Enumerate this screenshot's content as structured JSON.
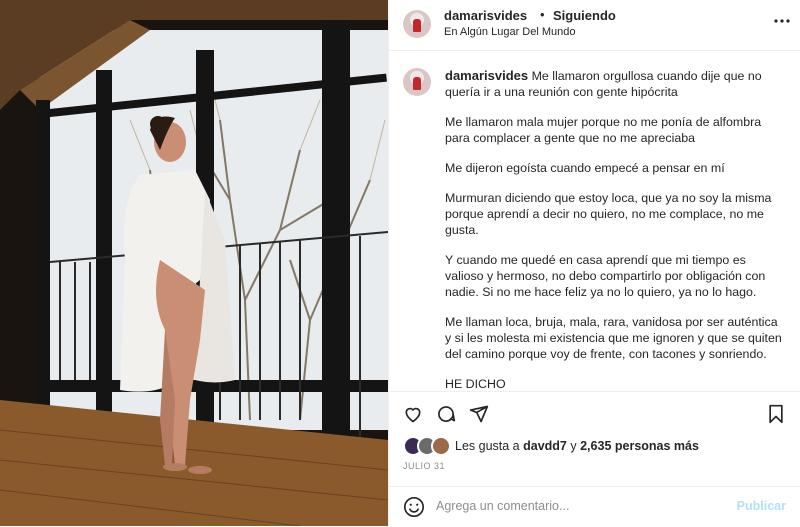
{
  "header": {
    "username": "damarisvides",
    "separator": "•",
    "follow_status": "Siguiendo",
    "location": "En Algún Lugar Del Mundo"
  },
  "caption": {
    "username": "damarisvides",
    "paragraphs": [
      "Me llamaron orgullosa cuando dije que no quería ir a una reunión con gente hipócrita",
      "Me llamaron mala mujer porque no me ponía de alfombra para complacer a gente que no me apreciaba",
      "Me dijeron egoísta cuando empecé a pensar en mí",
      "Murmuran diciendo que estoy loca, que ya no soy la misma porque aprendí a decir no quiero, no me complace, no me gusta.",
      "Y cuando me quedé en casa aprendí que mi tiempo es valioso y hermoso, no debo compartirlo por obligación con nadie. Si no me hace feliz ya no lo quiero, ya no lo hago.",
      "Me llaman loca, bruja, mala, rara, vanidosa por ser auténtica y si les molesta mi existencia que me ignoren y que se quiten del camino porque voy de frente, con tacones y sonriendo.",
      "HE DICHO"
    ]
  },
  "likes": {
    "prefix": "Les gusta a",
    "user": "davdd7",
    "joiner": "y",
    "count": "2,635 personas más"
  },
  "date": "JULIO 31",
  "comment": {
    "placeholder": "Agrega un comentario...",
    "publish": "Publicar"
  },
  "icons": {
    "header_more": "more-horizontal-icon",
    "like": "heart-icon",
    "comment": "comment-icon",
    "share": "paper-plane-icon",
    "save": "bookmark-icon",
    "emoji": "smiley-icon"
  },
  "colors": {
    "text": "#262626",
    "muted": "#8e8e8e",
    "publish_disabled": "#b2dffc",
    "divider": "#efefef"
  }
}
